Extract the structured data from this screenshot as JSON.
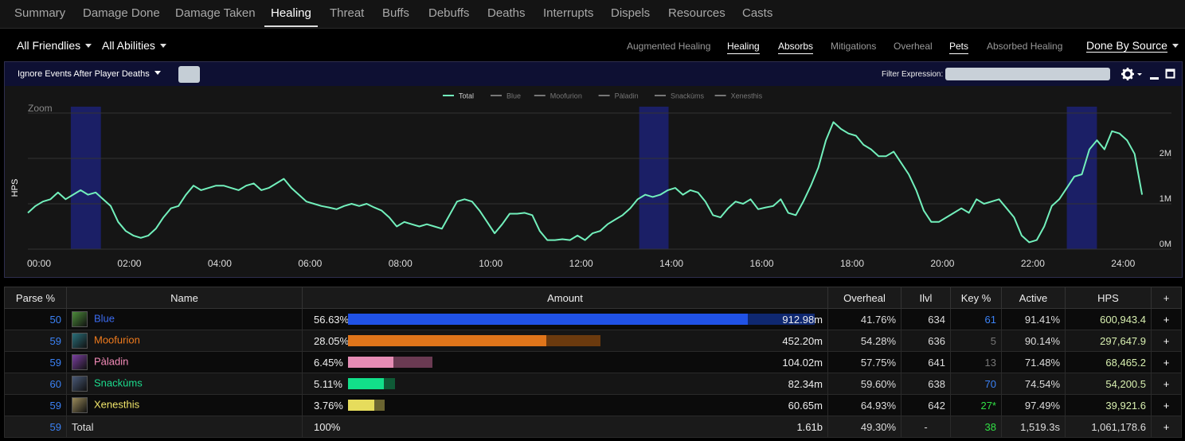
{
  "tabs": [
    "Summary",
    "Damage Done",
    "Damage Taken",
    "Healing",
    "Threat",
    "Buffs",
    "Debuffs",
    "Deaths",
    "Interrupts",
    "Dispels",
    "Resources",
    "Casts"
  ],
  "active_tab": "Healing",
  "filters": {
    "friendlies": "All Friendlies",
    "abilities": "All Abilities"
  },
  "view_options": [
    "Augmented Healing",
    "Healing",
    "Absorbs",
    "Mitigations",
    "Overheal",
    "Pets",
    "Absorbed Healing"
  ],
  "selected_view_options": [
    "Healing",
    "Absorbs",
    "Pets"
  ],
  "source_dropdown": "Done By Source",
  "graph": {
    "events_dropdown": "Ignore Events After Player Deaths",
    "filter_label": "Filter Expression:",
    "filter_value": "",
    "zoom_label": "Zoom",
    "y_axis_label": "HPS",
    "legend": [
      "Total",
      "Blue",
      "Moofurion",
      "Pàladin",
      "Snackùms",
      "Xenesthis"
    ],
    "colors": {
      "line": "#72f0bc",
      "band": "#1b1f66",
      "grid": "#333"
    }
  },
  "chart_data": {
    "type": "line",
    "xlabel": "",
    "ylabel": "HPS",
    "x_ticks": [
      "00:00",
      "02:00",
      "04:00",
      "06:00",
      "08:00",
      "10:00",
      "12:00",
      "14:00",
      "16:00",
      "18:00",
      "20:00",
      "22:00",
      "24:00"
    ],
    "y_ticks": [
      "0M",
      "1M",
      "2M"
    ],
    "xlim_seconds": [
      0,
      1519
    ],
    "ylim_millions": [
      0,
      3.0
    ],
    "highlight_ranges_seconds": [
      [
        57,
        97
      ],
      [
        812,
        851
      ],
      [
        1380,
        1420
      ]
    ],
    "series": [
      {
        "name": "Total",
        "x_seconds": [
          0,
          10,
          20,
          30,
          40,
          50,
          60,
          70,
          80,
          90,
          100,
          110,
          120,
          130,
          140,
          150,
          160,
          170,
          180,
          190,
          200,
          210,
          220,
          230,
          240,
          250,
          260,
          270,
          280,
          290,
          300,
          310,
          320,
          330,
          340,
          350,
          360,
          370,
          380,
          390,
          400,
          410,
          420,
          430,
          440,
          450,
          460,
          470,
          480,
          490,
          500,
          510,
          520,
          530,
          540,
          550,
          560,
          570,
          580,
          590,
          600,
          610,
          620,
          630,
          640,
          650,
          660,
          670,
          680,
          690,
          700,
          710,
          720,
          730,
          740,
          750,
          760,
          770,
          780,
          790,
          800,
          810,
          820,
          830,
          840,
          850,
          860,
          870,
          880,
          890,
          900,
          910,
          920,
          930,
          940,
          950,
          960,
          970,
          980,
          990,
          1000,
          1010,
          1020,
          1030,
          1040,
          1050,
          1060,
          1070,
          1080,
          1090,
          1100,
          1110,
          1120,
          1130,
          1140,
          1150,
          1160,
          1170,
          1180,
          1190,
          1200,
          1210,
          1220,
          1230,
          1240,
          1250,
          1260,
          1270,
          1280,
          1290,
          1300,
          1310,
          1320,
          1330,
          1340,
          1350,
          1360,
          1370,
          1380,
          1390,
          1400,
          1410,
          1420,
          1430,
          1440,
          1450,
          1460,
          1470,
          1480,
          1490,
          1500,
          1510,
          1519
        ],
        "values_millions": [
          0.8,
          0.95,
          1.05,
          1.1,
          1.25,
          1.1,
          1.2,
          1.3,
          1.2,
          1.25,
          1.1,
          0.95,
          0.6,
          0.4,
          0.3,
          0.25,
          0.3,
          0.45,
          0.7,
          0.9,
          0.95,
          1.2,
          1.4,
          1.3,
          1.35,
          1.4,
          1.4,
          1.35,
          1.3,
          1.4,
          1.45,
          1.3,
          1.35,
          1.45,
          1.55,
          1.35,
          1.2,
          1.05,
          1.0,
          0.95,
          0.92,
          0.88,
          0.95,
          1.0,
          0.95,
          1.0,
          0.92,
          0.85,
          0.7,
          0.5,
          0.6,
          0.55,
          0.5,
          0.55,
          0.5,
          0.45,
          0.75,
          1.05,
          1.1,
          1.05,
          0.85,
          0.6,
          0.35,
          0.55,
          0.78,
          0.78,
          0.8,
          0.75,
          0.4,
          0.2,
          0.2,
          0.22,
          0.2,
          0.3,
          0.2,
          0.35,
          0.4,
          0.55,
          0.65,
          0.75,
          0.9,
          1.1,
          1.2,
          1.15,
          1.2,
          1.3,
          1.35,
          1.2,
          1.3,
          1.25,
          1.05,
          0.75,
          0.7,
          0.9,
          1.05,
          1.0,
          1.1,
          0.88,
          0.92,
          0.95,
          1.1,
          0.8,
          0.75,
          1.05,
          1.4,
          1.8,
          2.4,
          2.8,
          2.65,
          2.55,
          2.5,
          2.3,
          2.2,
          2.05,
          2.05,
          2.15,
          1.9,
          1.65,
          1.3,
          0.85,
          0.6,
          0.6,
          0.7,
          0.8,
          0.9,
          0.8,
          1.1,
          1.0,
          1.05,
          1.1,
          0.9,
          0.7,
          0.3,
          0.15,
          0.2,
          0.5,
          0.95,
          1.1,
          1.35,
          1.6,
          1.65,
          2.2,
          2.4,
          2.2,
          2.6,
          2.55,
          2.4,
          2.1,
          1.2
        ]
      }
    ]
  },
  "table": {
    "headers": [
      "Parse %",
      "Name",
      "Amount",
      "Overheal",
      "Ilvl",
      "Key %",
      "Active",
      "HPS",
      "+"
    ],
    "rows": [
      {
        "parse": "50",
        "name": "Blue",
        "name_color": "#3b6bef",
        "icon": "monk-mistweaver-icon",
        "icon_color": "#4c8a3a",
        "amount_pct": "56.63%",
        "amount": "912.98m",
        "bar_fill": 0.5663,
        "bar_over": 0.0946,
        "bar_color": "#2052e6",
        "bar_over_color": "#0f2870",
        "overheal": "41.76%",
        "ilvl": "634",
        "key": "61",
        "key_class": "blue",
        "active": "91.41%",
        "hps": "600,943.4"
      },
      {
        "parse": "59",
        "name": "Moofurion",
        "name_color": "#f07b1d",
        "icon": "druid-restoration-icon",
        "icon_color": "#2a6f7a",
        "amount_pct": "28.05%",
        "amount": "452.20m",
        "bar_fill": 0.2805,
        "bar_over": 0.0766,
        "bar_color": "#e0751a",
        "bar_over_color": "#6b3a0e",
        "overheal": "54.28%",
        "ilvl": "636",
        "key": "5",
        "key_class": "gray",
        "active": "90.14%",
        "hps": "297,647.9"
      },
      {
        "parse": "59",
        "name": "Pàladin",
        "name_color": "#f58cba",
        "icon": "evoker-preservation-icon",
        "icon_color": "#7a3fa0",
        "amount_pct": "6.45%",
        "amount": "104.02m",
        "bar_fill": 0.0645,
        "bar_over": 0.0548,
        "bar_color": "#e58cb4",
        "bar_over_color": "#6a3a52",
        "overheal": "57.75%",
        "ilvl": "641",
        "key": "13",
        "key_class": "gray",
        "active": "71.48%",
        "hps": "68,465.2"
      },
      {
        "parse": "60",
        "name": "Snackùms",
        "name_color": "#1cdc8e",
        "icon": "shaman-restoration-icon",
        "icon_color": "#4a5a78",
        "amount_pct": "5.11%",
        "amount": "82.34m",
        "bar_fill": 0.0511,
        "bar_over": 0.0156,
        "bar_color": "#12e08a",
        "bar_over_color": "#0f5a36",
        "overheal": "59.60%",
        "ilvl": "638",
        "key": "70",
        "key_class": "blue",
        "active": "74.54%",
        "hps": "54,200.5"
      },
      {
        "parse": "59",
        "name": "Xenesthis",
        "name_color": "#f0e56a",
        "icon": "priest-holy-icon",
        "icon_color": "#9a8a5a",
        "amount_pct": "3.76%",
        "amount": "60.65m",
        "bar_fill": 0.0376,
        "bar_over": 0.0148,
        "bar_color": "#e6dc5c",
        "bar_over_color": "#6a6430",
        "overheal": "64.93%",
        "ilvl": "642",
        "key": "27*",
        "key_class": "green",
        "active": "97.49%",
        "hps": "39,921.6"
      }
    ],
    "total": {
      "parse": "59",
      "name": "Total",
      "amount_pct": "100%",
      "amount": "1.61b",
      "overheal": "49.30%",
      "ilvl": "-",
      "key": "38",
      "active": "1,519.3s",
      "hps": "1,061,178.6"
    },
    "plus": "+"
  }
}
